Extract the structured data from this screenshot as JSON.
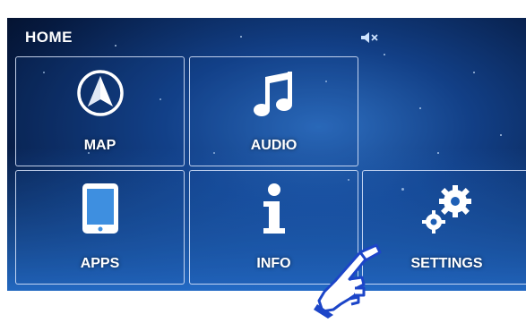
{
  "header": {
    "title": "HOME",
    "status_icon": "speaker-mute-icon"
  },
  "tiles": {
    "map": {
      "label": "MAP",
      "icon": "navigation-arrow-icon"
    },
    "audio": {
      "label": "AUDIO",
      "icon": "music-note-icon"
    },
    "apps": {
      "label": "APPS",
      "icon": "tablet-icon"
    },
    "info": {
      "label": "INFO",
      "icon": "info-icon"
    },
    "settings": {
      "label": "SETTINGS",
      "icon": "gears-icon"
    }
  },
  "overlay": {
    "icon": "pointing-hand-icon"
  },
  "colors": {
    "accent": "#2e6fc0",
    "background_dark": "#061a40",
    "tile_border": "#e1ebff",
    "hand": "#1c45c8"
  }
}
